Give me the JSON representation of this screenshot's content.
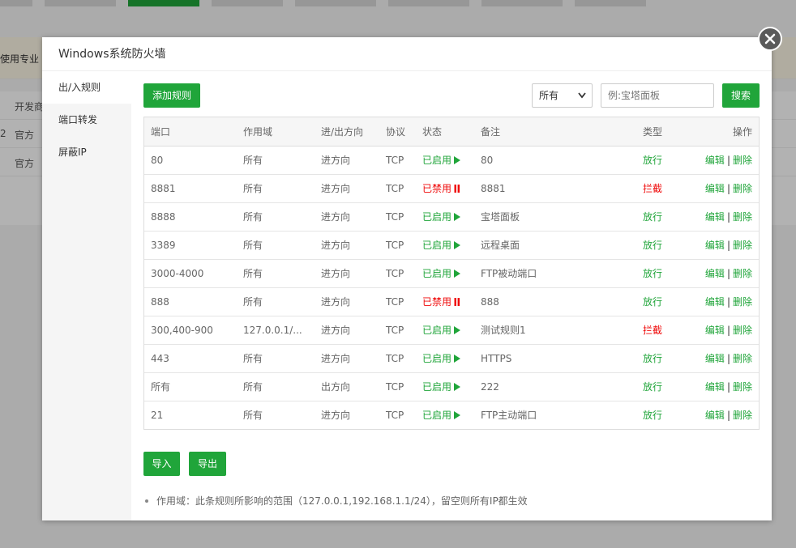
{
  "background": {
    "notice_text": "使用专业",
    "rows": [
      {
        "col1": "开发商"
      },
      {
        "col0": "2",
        "col1": "官方"
      },
      {
        "col1": "官方"
      }
    ]
  },
  "modal": {
    "title": "Windows系统防火墙",
    "close_icon": "close-icon"
  },
  "sidebar": {
    "items": [
      {
        "label": "出/入规则"
      },
      {
        "label": "端口转发"
      },
      {
        "label": "屏蔽IP"
      }
    ]
  },
  "toolbar": {
    "add_label": "添加规则",
    "filter_selected": "所有",
    "search_placeholder": "例:宝塔面板",
    "search_label": "搜索"
  },
  "table": {
    "headers": {
      "port": "端口",
      "scope": "作用域",
      "direction": "进/出方向",
      "protocol": "协议",
      "status": "状态",
      "remark": "备注",
      "type": "类型",
      "action": "操作"
    },
    "rows": [
      {
        "port": "80",
        "scope": "所有",
        "direction": "进方向",
        "protocol": "TCP",
        "status": "已启用",
        "remark": "80",
        "type": "放行"
      },
      {
        "port": "8881",
        "scope": "所有",
        "direction": "进方向",
        "protocol": "TCP",
        "status": "已禁用",
        "remark": "8881",
        "type": "拦截"
      },
      {
        "port": "8888",
        "scope": "所有",
        "direction": "进方向",
        "protocol": "TCP",
        "status": "已启用",
        "remark": "宝塔面板",
        "type": "放行"
      },
      {
        "port": "3389",
        "scope": "所有",
        "direction": "进方向",
        "protocol": "TCP",
        "status": "已启用",
        "remark": "远程桌面",
        "type": "放行"
      },
      {
        "port": "3000-4000",
        "scope": "所有",
        "direction": "进方向",
        "protocol": "TCP",
        "status": "已启用",
        "remark": "FTP被动端口",
        "type": "放行"
      },
      {
        "port": "888",
        "scope": "所有",
        "direction": "进方向",
        "protocol": "TCP",
        "status": "已禁用",
        "remark": "888",
        "type": "放行"
      },
      {
        "port": "300,400-900",
        "scope": "127.0.0.1/...",
        "direction": "进方向",
        "protocol": "TCP",
        "status": "已启用",
        "remark": "测试规则1",
        "type": "拦截"
      },
      {
        "port": "443",
        "scope": "所有",
        "direction": "进方向",
        "protocol": "TCP",
        "status": "已启用",
        "remark": "HTTPS",
        "type": "放行"
      },
      {
        "port": "所有",
        "scope": "所有",
        "direction": "出方向",
        "protocol": "TCP",
        "status": "已启用",
        "remark": "222",
        "type": "放行"
      },
      {
        "port": "21",
        "scope": "所有",
        "direction": "进方向",
        "protocol": "TCP",
        "status": "已启用",
        "remark": "FTP主动端口",
        "type": "放行"
      }
    ],
    "edit_label": "编辑",
    "delete_label": "删除",
    "separator": "|",
    "status_on_icon": "play-icon",
    "status_off_icon": "pause-icon"
  },
  "footer": {
    "import_label": "导入",
    "export_label": "导出",
    "tip": "作用域：此条规则所影响的范围（127.0.0.1,192.168.1.1/24），留空则所有IP都生效"
  },
  "colors": {
    "accent": "#20a53a",
    "danger": "#ef0808"
  }
}
